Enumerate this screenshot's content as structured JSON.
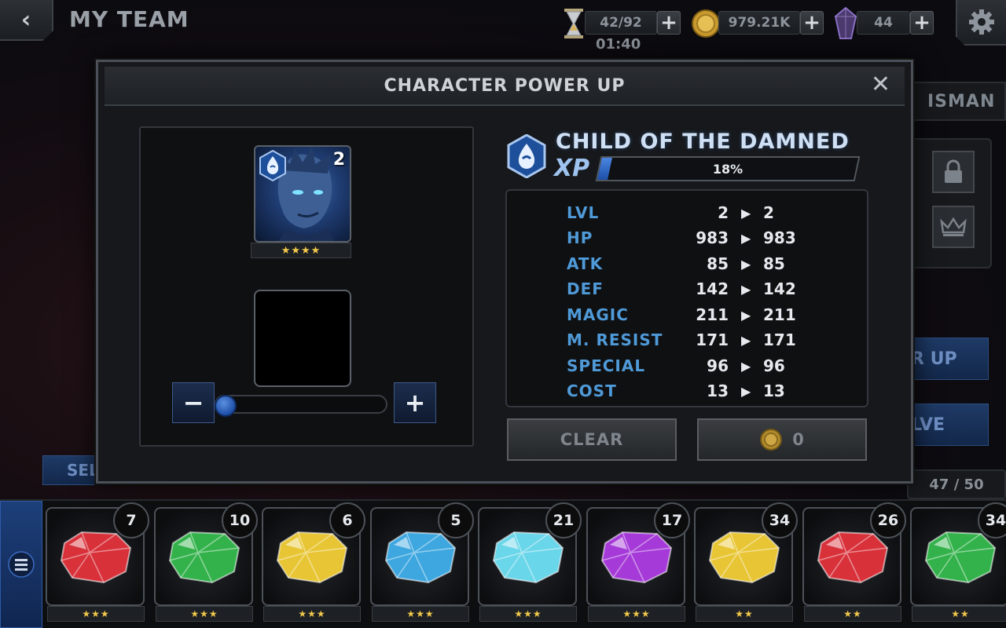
{
  "topbar": {
    "back_label": "‹",
    "title": "MY TEAM",
    "energy": {
      "value": "42/92",
      "timer": "01:40"
    },
    "gold": {
      "value": "979.21K"
    },
    "crystals": {
      "value": "44"
    },
    "plus_label": "+"
  },
  "background": {
    "tab_partial": "ISMAN",
    "power_up_partial": "R UP",
    "evolve_partial": "LVE",
    "sell_partial": "SELL",
    "roster_count": "47 / 50"
  },
  "modal": {
    "title": "CHARACTER POWER UP",
    "close_label": "✕",
    "portrait": {
      "level": "2",
      "stars": "★★★★"
    },
    "slider": {
      "minus_label": "−",
      "plus_label": "+",
      "value_fraction": 0
    },
    "character_name": "CHILD OF THE DAMNED",
    "xp_label": "XP",
    "xp_percent": "18%",
    "xp_fraction": 0.18,
    "stats": [
      {
        "label": "LVL",
        "from": "2",
        "to": "2"
      },
      {
        "label": "HP",
        "from": "983",
        "to": "983"
      },
      {
        "label": "ATK",
        "from": "85",
        "to": "85"
      },
      {
        "label": "DEF",
        "from": "142",
        "to": "142"
      },
      {
        "label": "MAGIC",
        "from": "211",
        "to": "211"
      },
      {
        "label": "M. RESIST",
        "from": "171",
        "to": "171"
      },
      {
        "label": "SPECIAL",
        "from": "96",
        "to": "96"
      },
      {
        "label": "COST",
        "from": "13",
        "to": "13"
      }
    ],
    "arrow": "▶",
    "clear_label": "CLEAR",
    "cost_value": "0"
  },
  "tray": {
    "menu_icon": "menu-icon",
    "gems": [
      {
        "count": "7",
        "stars": "★★★",
        "color": "#d8313a"
      },
      {
        "count": "10",
        "stars": "★★★",
        "color": "#33b24b"
      },
      {
        "count": "6",
        "stars": "★★★",
        "color": "#e8c534"
      },
      {
        "count": "5",
        "stars": "★★★",
        "color": "#3ea7e0"
      },
      {
        "count": "21",
        "stars": "★★★",
        "color": "#6ad6ea"
      },
      {
        "count": "17",
        "stars": "★★★",
        "color": "#a53ad8"
      },
      {
        "count": "34",
        "stars": "★★",
        "color": "#e8c534"
      },
      {
        "count": "26",
        "stars": "★★",
        "color": "#d8313a"
      },
      {
        "count": "34",
        "stars": "★★",
        "color": "#33b24b"
      }
    ]
  },
  "colors": {
    "accent_blue": "#4f9ad8",
    "star_gold": "#f2c94c",
    "xp_fill": "#3f7bd6"
  }
}
